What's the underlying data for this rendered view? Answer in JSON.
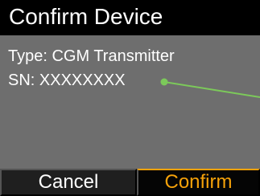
{
  "screen": {
    "title": "Confirm Device",
    "type_label": "Type: CGM Transmitter",
    "serial_label": "SN: XXXXXXXX"
  },
  "actions": {
    "cancel_label": "Cancel",
    "confirm_label": "Confirm"
  },
  "colors": {
    "background": "#6e6e6e",
    "header": "#000000",
    "accent": "#f6a20a",
    "callout": "#7cc95a"
  }
}
